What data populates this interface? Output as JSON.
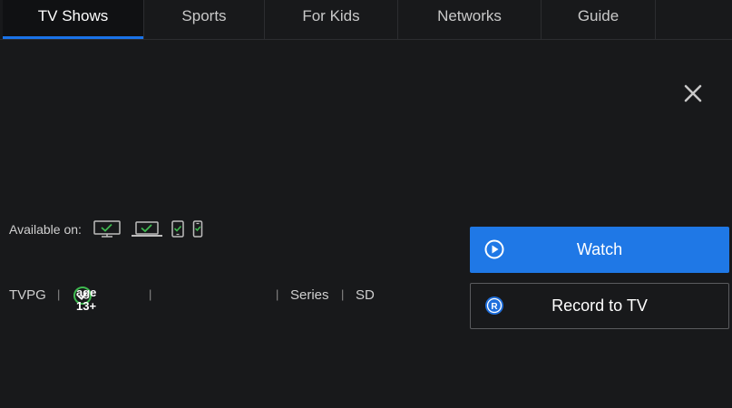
{
  "nav": {
    "tabs": [
      {
        "label": "TV Shows",
        "active": true
      },
      {
        "label": "Sports"
      },
      {
        "label": "For Kids"
      },
      {
        "label": "Networks"
      },
      {
        "label": "Guide"
      }
    ]
  },
  "availability": {
    "label": "Available on:",
    "devices": [
      "tv-icon",
      "laptop-icon",
      "tablet-icon",
      "phone-icon"
    ]
  },
  "meta": {
    "rating": "TVPG",
    "separator": "|",
    "age": "age 13+",
    "type": "Series",
    "quality": "SD"
  },
  "actions": {
    "watch_label": "Watch",
    "record_label": "Record to TV"
  },
  "colors": {
    "background": "#18191b",
    "accent": "#1f78e6",
    "check_green": "#3fb950"
  }
}
